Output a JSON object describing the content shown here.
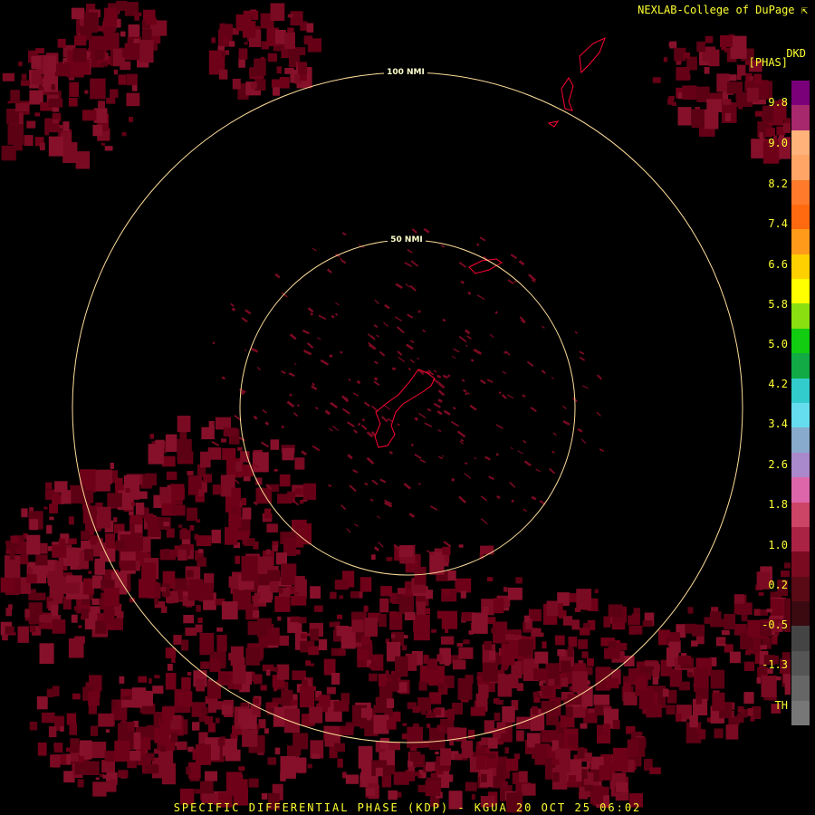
{
  "header": {
    "credit": "NEXLAB-College of DuPage",
    "credit_icon": "cursor-arrow-icon",
    "product_code": "DKD",
    "product_unit": "[PHAS]"
  },
  "map": {
    "range_rings": [
      {
        "label": "100 NMI"
      },
      {
        "label": "50 NMI"
      }
    ],
    "ring_color": "#ffdd99",
    "coastline_color": "#ff0033",
    "echo_color": "#6e0018",
    "background": "#000000"
  },
  "legend": {
    "ticks": [
      "9.8",
      "9.0",
      "8.2",
      "7.4",
      "6.6",
      "5.8",
      "5.0",
      "4.2",
      "3.4",
      "2.6",
      "1.8",
      "1.0",
      "0.2",
      "-0.5",
      "-1.3",
      "TH"
    ],
    "colors": [
      "#7a007a",
      "#a8286e",
      "#ffb27a",
      "#ffa566",
      "#ff7a2a",
      "#ff6a10",
      "#ff9a1a",
      "#ffd000",
      "#ffff00",
      "#8adf10",
      "#11cc11",
      "#11aa44",
      "#33cccc",
      "#66ddee",
      "#88aacc",
      "#aa88cc",
      "#dd66aa",
      "#cc4466",
      "#aa2244",
      "#7a0a20",
      "#5a0a14",
      "#3a0a10",
      "#444444",
      "#555555",
      "#666666",
      "#777777"
    ]
  },
  "footer": {
    "text": "SPECIFIC DIFFERENTIAL PHASE (KDP) - KGUA 20 OCT 25 06:02"
  }
}
